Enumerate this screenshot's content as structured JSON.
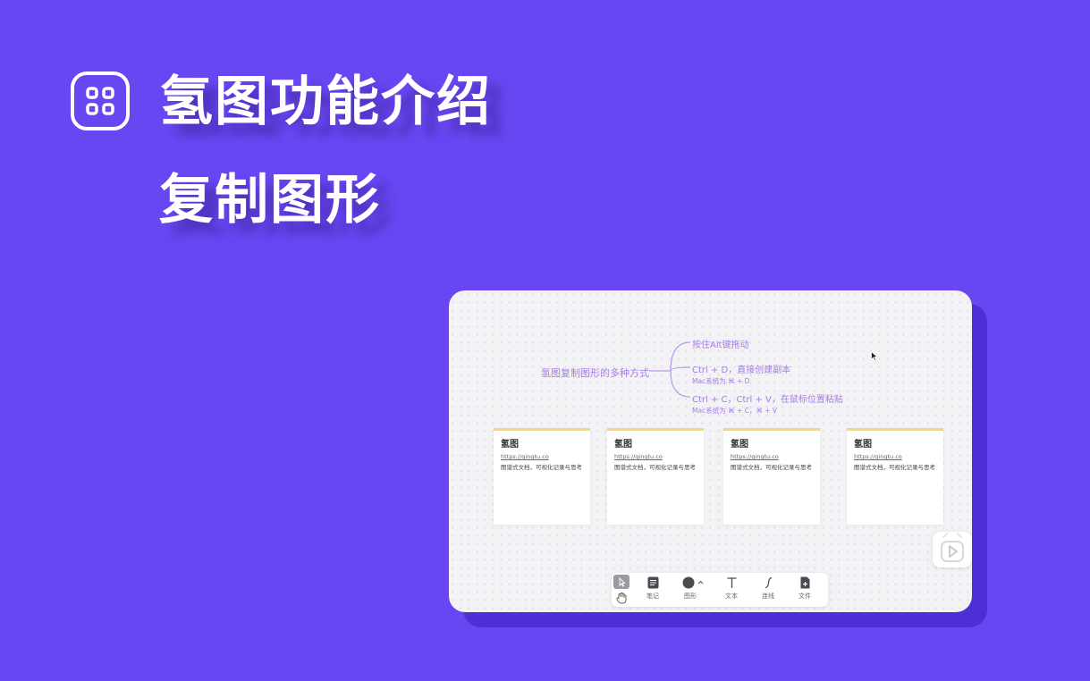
{
  "header": {
    "title": "氢图功能介绍",
    "subtitle": "复制图形",
    "icon": "app-grid-icon"
  },
  "colors": {
    "background": "#6846f2",
    "accent_text": "#a67ce6",
    "card_top_border": "#f5d77b"
  },
  "mindmap": {
    "root": "氢图复制图形的多种方式",
    "branches": [
      {
        "main": "按住Alt键拖动",
        "sub": ""
      },
      {
        "main": "Ctrl + D，直接创建副本",
        "sub": "Mac系统为 ⌘ + D"
      },
      {
        "main": "Ctrl + C，Ctrl + V，在鼠标位置粘贴",
        "sub": "Mac系统为 ⌘ + C，⌘ + V"
      }
    ]
  },
  "cards": [
    {
      "title": "氢图",
      "link": "https://qingtu.co",
      "desc": "图谱式文档，可视化记录与思考"
    },
    {
      "title": "氢图",
      "link": "https://qingtu.co",
      "desc": "图谱式文档，可视化记录与思考"
    },
    {
      "title": "氢图",
      "link": "https://qingtu.co",
      "desc": "图谱式文档，可视化记录与思考"
    },
    {
      "title": "氢图",
      "link": "https://qingtu.co",
      "desc": "图谱式文档，可视化记录与思考"
    }
  ],
  "toolbar": {
    "items": [
      {
        "label": "笔记",
        "icon": "note-icon"
      },
      {
        "label": "图形",
        "icon": "shape-icon"
      },
      {
        "label": "文本",
        "icon": "text-icon"
      },
      {
        "label": "连线",
        "icon": "connector-icon"
      },
      {
        "label": "文件",
        "icon": "file-icon"
      }
    ],
    "select_icon": "cursor-select-icon",
    "hand_icon": "hand-icon"
  },
  "play_button_icon": "play-icon"
}
